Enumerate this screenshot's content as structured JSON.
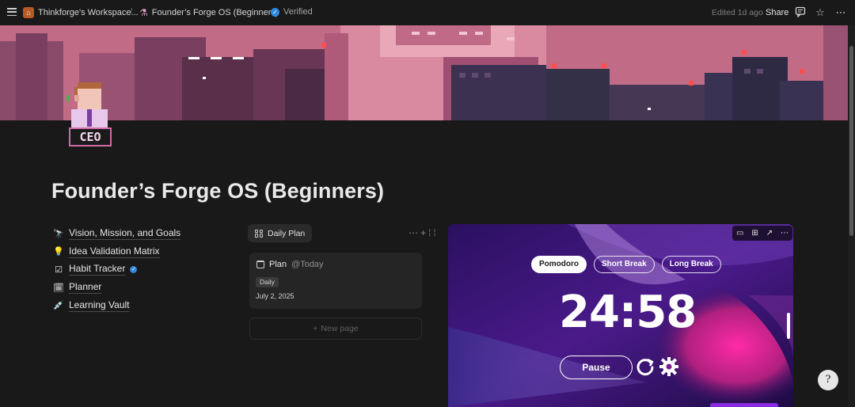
{
  "topbar": {
    "workspace": "Thinkforge's Workspace...",
    "page": "Founder’s Forge OS (Beginners)",
    "verified": "Verified",
    "edited": "Edited 1d ago",
    "share": "Share"
  },
  "avatar": {
    "badge": "CEO"
  },
  "page_title": "Founder’s Forge OS (Beginners)",
  "nav": [
    {
      "icon": "telescope-icon",
      "glyph": "🔭",
      "label": "Vision, Mission, and Goals"
    },
    {
      "icon": "lightbulb-icon",
      "glyph": "💡",
      "label": "Idea Validation Matrix"
    },
    {
      "icon": "checklist-icon",
      "glyph": "☑",
      "label": "Habit Tracker"
    },
    {
      "icon": "planner-icon",
      "glyph": "🗓",
      "label": "Planner"
    },
    {
      "icon": "vault-icon",
      "glyph": "💉",
      "label": "Learning Vault"
    }
  ],
  "board": {
    "view_label": "Daily Plan",
    "card": {
      "title": "Plan",
      "mention": "@Today",
      "tag": "Daily",
      "date": "July 2, 2025"
    },
    "new_page": "New page"
  },
  "pomodoro": {
    "modes": [
      "Pomodoro",
      "Short Break",
      "Long Break"
    ],
    "active_mode": "Pomodoro",
    "time": "24:58",
    "pause_label": "Pause"
  },
  "help": {
    "glyph": "?"
  },
  "colors": {
    "banner": "#c26b86",
    "page_bg": "#191919",
    "accent_blue": "#2f88e0",
    "pomo_bg": "#2a0d52"
  }
}
